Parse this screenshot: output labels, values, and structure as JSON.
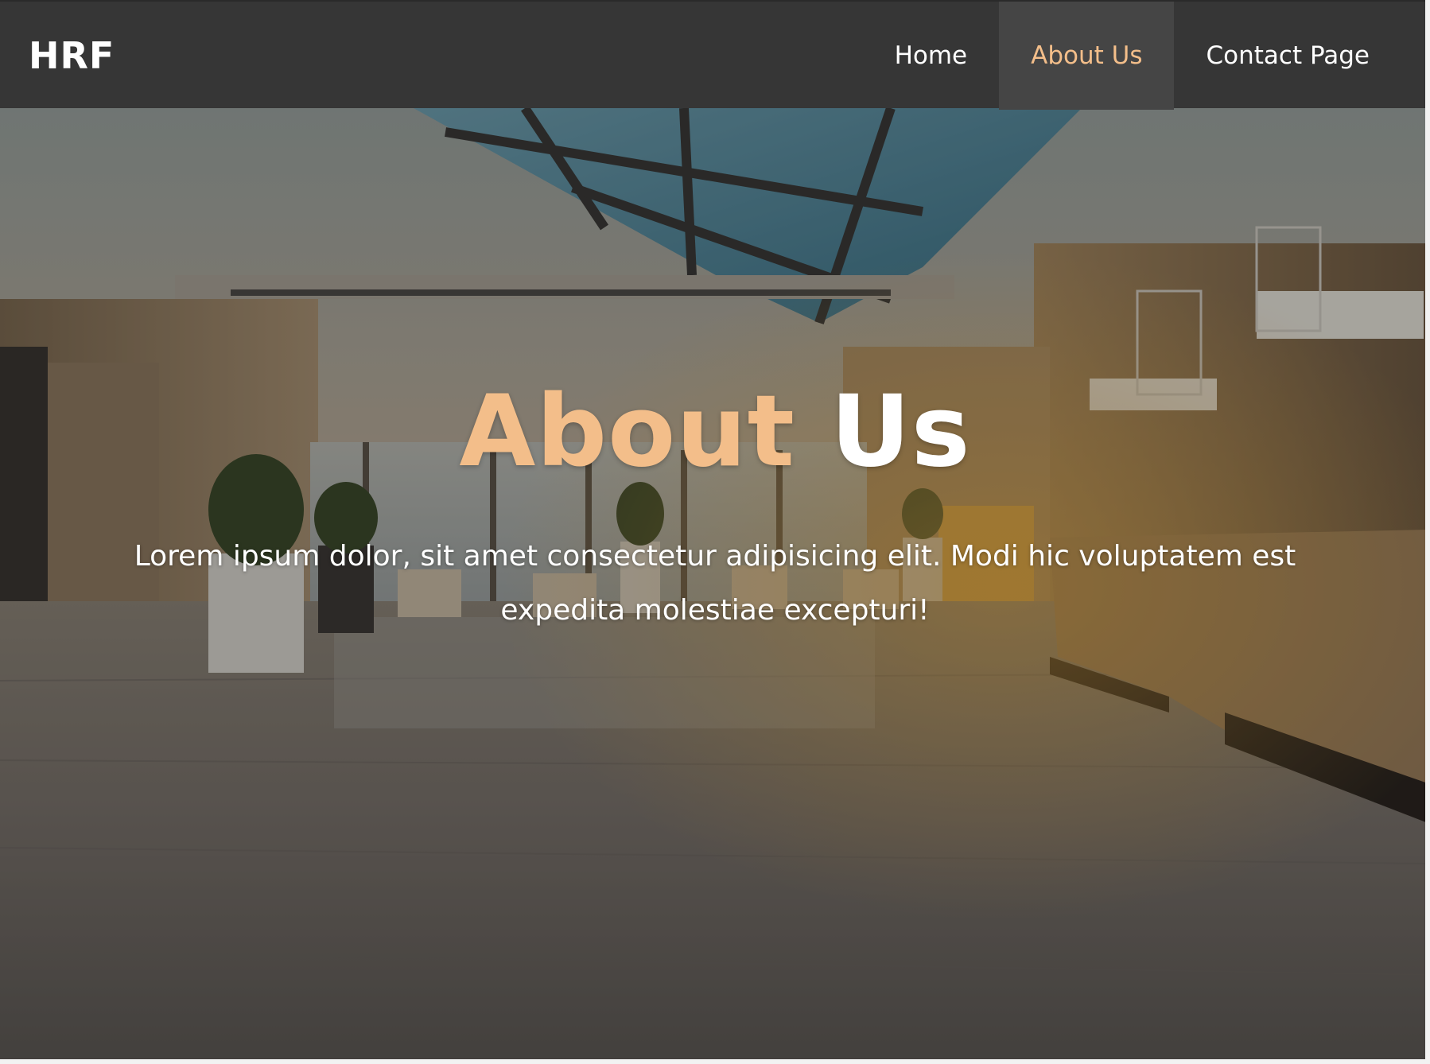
{
  "navbar": {
    "brand": "HRF",
    "items": [
      {
        "label": "Home",
        "active": false
      },
      {
        "label": "About Us",
        "active": true
      },
      {
        "label": "Contact Page",
        "active": false
      }
    ]
  },
  "hero": {
    "title_accent": "About",
    "title_rest": "Us",
    "text": "Lorem ipsum dolor, sit amet consectetur adipisicing elit. Modi hic voluptatem est expedita molestiae excepturi!",
    "background_description_icon": "hotel-lobby-photo"
  },
  "colors": {
    "navbar_bg": "#363636",
    "active_nav_bg": "#454545",
    "accent": "#f3be8a",
    "text": "#ffffff"
  }
}
